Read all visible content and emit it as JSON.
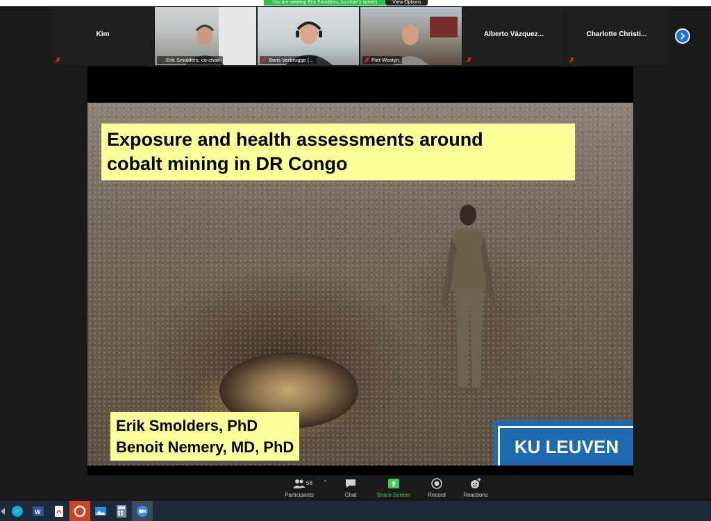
{
  "share_banner": {
    "message": "You are viewing Erik Smolders, co-chair's screen",
    "view_options": "View Options"
  },
  "participants": [
    {
      "name": "Kim",
      "video": false
    },
    {
      "name": "Erik Smolders, co-chair",
      "video": true
    },
    {
      "name": "Boris Verbrugge (...",
      "video": true
    },
    {
      "name": "Piet Wostyn",
      "video": true
    },
    {
      "name": "Alberto  Vázquez...",
      "video": false
    },
    {
      "name": "Charlotte  Christi...",
      "video": false
    }
  ],
  "slide": {
    "title_line1": "Exposure and health assessments around",
    "title_line2": "cobalt mining in DR Congo",
    "author1": "Erik Smolders, PhD",
    "author2": "Benoit Nemery, MD, PhD",
    "logo": "KU LEUVEN"
  },
  "toolbar": {
    "participants_count": "56",
    "participants_label": "Participants",
    "chat_label": "Chat",
    "share_label": "Share Screen",
    "record_label": "Record",
    "reactions_label": "Reactions"
  },
  "taskbar_icons": [
    "system-icon",
    "edge-icon",
    "word-icon",
    "pdf-icon",
    "presentation-icon",
    "photos-icon",
    "calculator-icon",
    "zoom-icon"
  ],
  "colors": {
    "slide_highlight": "#ffff99",
    "share_green": "#2fbf4a",
    "ku_leuven_blue": "#1d6ab0",
    "next_button": "#1f6fe0"
  }
}
